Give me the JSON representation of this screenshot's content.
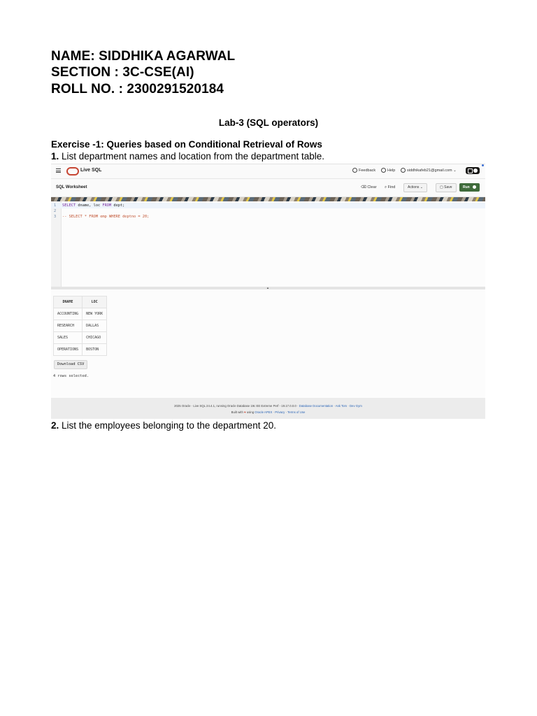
{
  "header": {
    "name": "NAME: SIDDHIKA AGARWAL",
    "section": "SECTION : 3C-CSE(AI)",
    "roll": "ROLL NO. : 2300291520184"
  },
  "lab_title": "Lab-3 (SQL operators)",
  "exercise_title": "Exercise -1:  Queries based on Conditional Retrieval of Rows",
  "questions": [
    {
      "number": "1.",
      "text": " List department names and location from the department table."
    },
    {
      "number": "2.",
      "text": " List the employees belonging to the department 20."
    }
  ],
  "screenshot": {
    "app_title": "Live SQL",
    "feedback": "Feedback",
    "help": "Help",
    "user_email": "siddhikafeb21@gmail.com",
    "worksheet_title": "SQL Worksheet",
    "toolbar": {
      "clear": "Clear",
      "find": "Find",
      "actions": "Actions",
      "save": "Save",
      "run": "Run"
    },
    "code_lines": [
      {
        "num": "1",
        "parts": [
          [
            "kw",
            "SELECT"
          ],
          [
            "tx",
            " dname, loc "
          ],
          [
            "kw",
            "FROM"
          ],
          [
            "tx",
            " dept;"
          ]
        ]
      },
      {
        "num": "2",
        "parts": []
      },
      {
        "num": "3",
        "parts": [
          [
            "cm",
            "-- SELECT * FROM emp WHERE deptno = 20;"
          ]
        ]
      }
    ],
    "result_table": {
      "columns": [
        "DNAME",
        "LOC"
      ],
      "rows": [
        [
          "ACCOUNTING",
          "NEW YORK"
        ],
        [
          "RESEARCH",
          "DALLAS"
        ],
        [
          "SALES",
          "CHICAGO"
        ],
        [
          "OPERATIONS",
          "BOSTON"
        ]
      ]
    },
    "download_label": "Download CSV",
    "rows_selected": "4 rows selected.",
    "footer_line1_text": "2025 Oracle · Live SQL 24.4.1, running Oracle Database 19c EE Extreme Perf - 19.17.0.0.0 · ",
    "footer_links1": [
      "Database Documentation",
      "Ask Tom",
      "Dev Gym"
    ],
    "footer_built": "Built with",
    "footer_using": "using",
    "footer_links2": [
      "Oracle APEX",
      "Privacy",
      "Terms of Use"
    ]
  }
}
